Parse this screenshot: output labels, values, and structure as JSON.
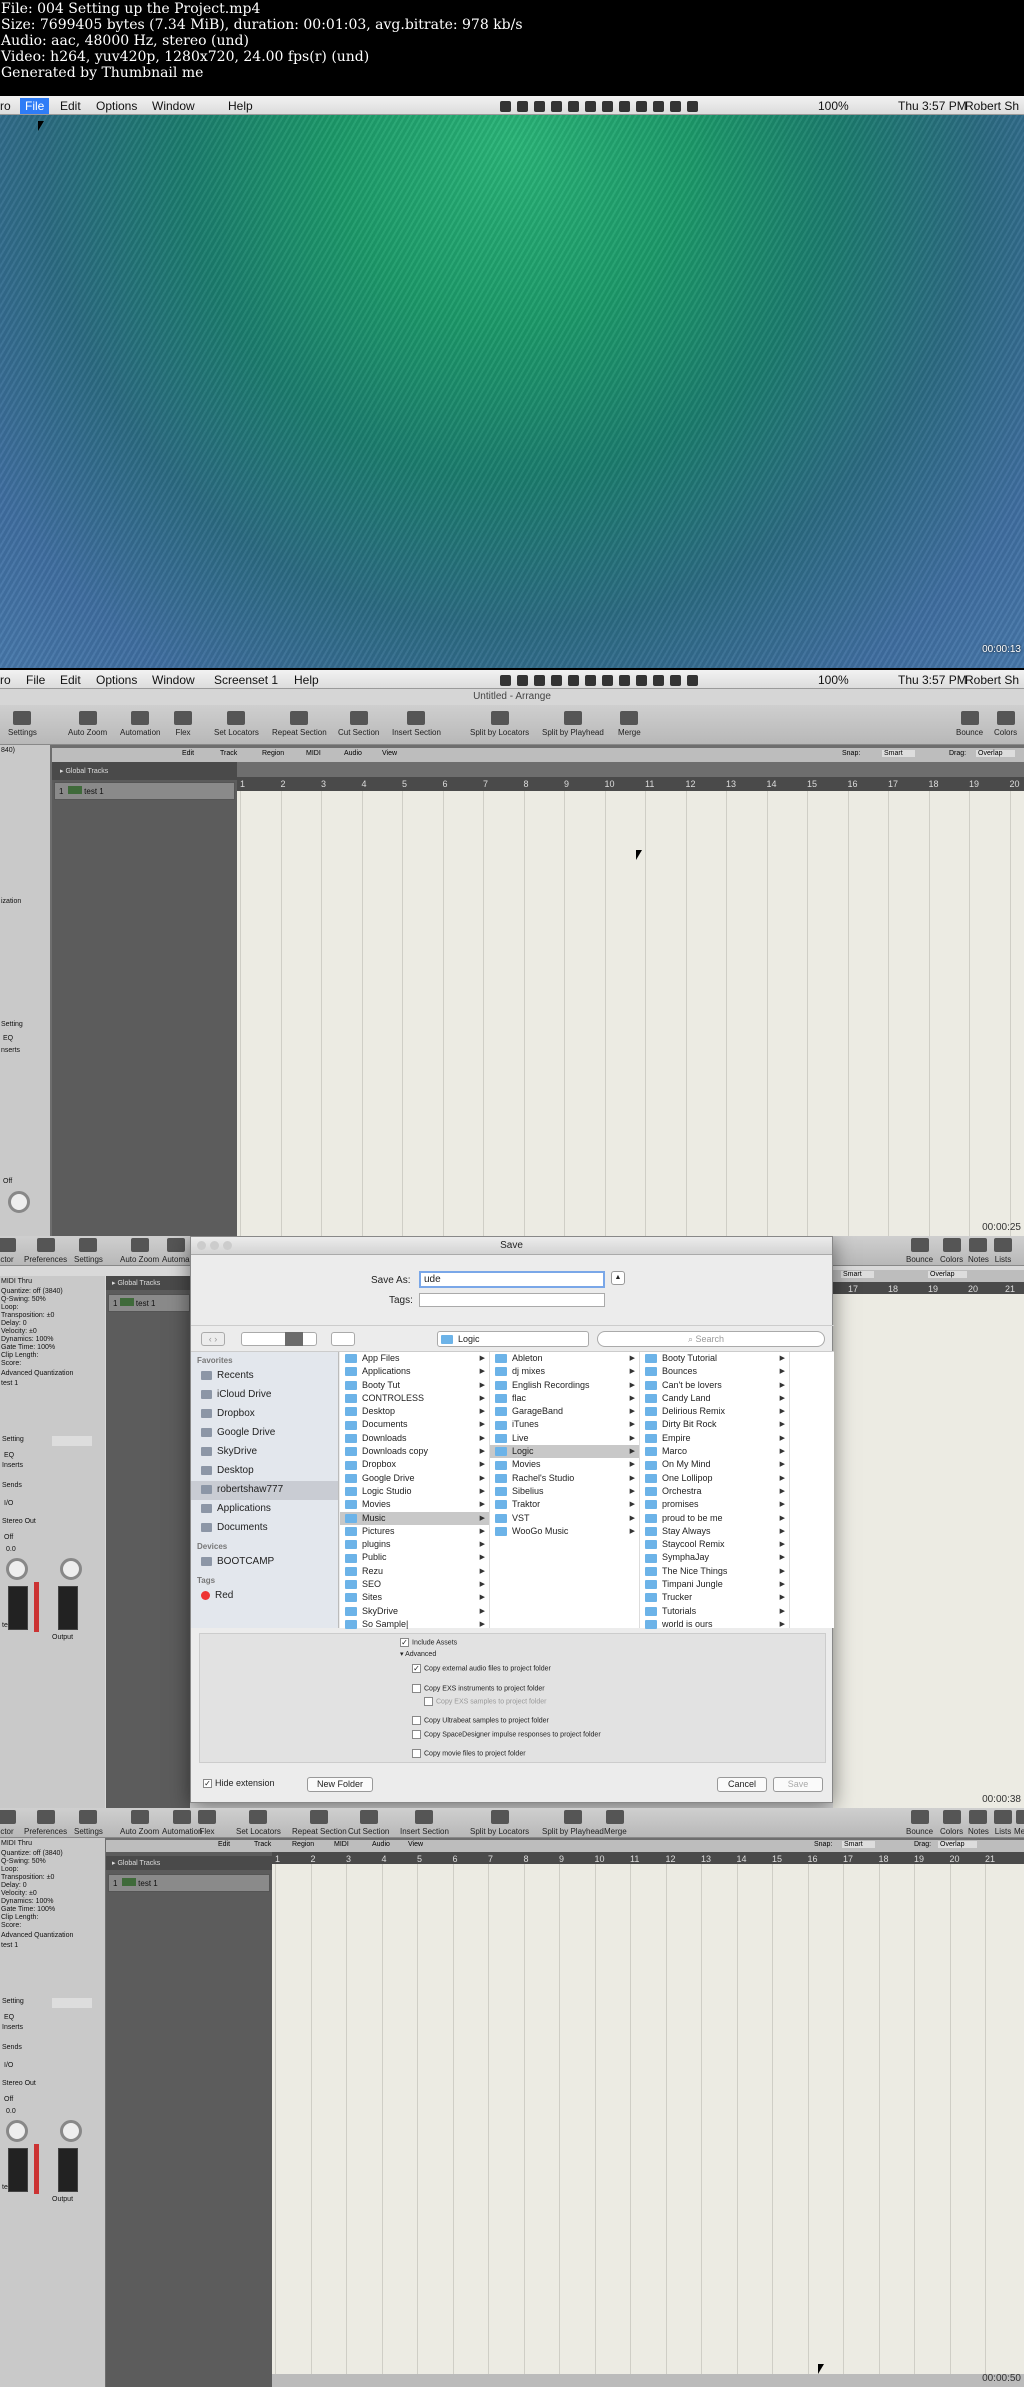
{
  "meta": {
    "lines": [
      "File: 004 Setting up the Project.mp4",
      "Size: 7699405 bytes (7.34 MiB), duration: 00:01:03, avg.bitrate: 978 kb/s",
      "Audio: aac, 48000 Hz, stereo (und)",
      "Video: h264, yuv420p, 1280x720, 24.00 fps(r) (und)",
      "Generated by Thumbnail me"
    ]
  },
  "frame1": {
    "menu": {
      "app": "ro",
      "items": [
        "File",
        "Edit",
        "Options",
        "Window",
        "Help"
      ],
      "right": {
        "battery": "100%",
        "clock": "Thu 3:57 PM",
        "user": "Robert Sh"
      }
    },
    "timestamp": "00:00:13"
  },
  "frame2": {
    "menu": {
      "app": "ro",
      "items": [
        "File",
        "Edit",
        "Options",
        "Window",
        "Screenset 1",
        "Help"
      ],
      "right": {
        "battery": "100%",
        "clock": "Thu 3:57 PM",
        "user": "Robert Sh"
      }
    },
    "title": "Untitled - Arrange",
    "toolbar": [
      "Settings",
      "Auto Zoom",
      "Automation",
      "Flex",
      "Set Locators",
      "Repeat Section",
      "Cut Section",
      "Insert Section",
      "Split by Locators",
      "Split by Playhead",
      "Merge",
      "Bounce",
      "Colors"
    ],
    "subtoolbar": [
      "Edit",
      "Track",
      "Region",
      "MIDI",
      "Audio",
      "View"
    ],
    "snap": "Snap:",
    "snap_val": "Smart",
    "drag": "Drag:",
    "drag_val": "Overlap",
    "ruler": [
      "1",
      "2",
      "3",
      "4",
      "5",
      "6",
      "7",
      "8",
      "9",
      "10",
      "11",
      "12",
      "13",
      "14",
      "15",
      "16",
      "17",
      "18",
      "19",
      "20"
    ],
    "global_tracks": "Global Tracks",
    "track": {
      "num": "1",
      "name": "test 1"
    },
    "insp_labels": [
      "840)",
      "ization",
      "Setting",
      "EQ",
      "nserts",
      "Off"
    ],
    "timestamp": "00:00:25"
  },
  "frame3": {
    "dialog": {
      "title": "Save",
      "save_as_label": "Save As:",
      "save_as_value": "ude",
      "tags_label": "Tags:",
      "location": "Logic",
      "search_placeholder": "Search",
      "favorites_header": "Favorites",
      "favorites": [
        "Recents",
        "iCloud Drive",
        "Dropbox",
        "Google Drive",
        "SkyDrive",
        "Desktop",
        "robertshaw777",
        "Applications",
        "Documents"
      ],
      "devices_header": "Devices",
      "devices": [
        "BOOTCAMP"
      ],
      "tags_header": "Tags",
      "tags": [
        "Red"
      ],
      "col1": [
        "App Files",
        "Applications",
        "Booty Tut",
        "CONTROLESS",
        "Desktop",
        "Documents",
        "Downloads",
        "Downloads copy",
        "Dropbox",
        "Google Drive",
        "Logic Studio",
        "Movies",
        "Music",
        "Pictures",
        "plugins",
        "Public",
        "Rezu",
        "SEO",
        "Sites",
        "SkyDrive",
        "So Sample|"
      ],
      "col2": [
        "Ableton",
        "dj mixes",
        "English Recordings",
        "flac",
        "GarageBand",
        "iTunes",
        "Live",
        "Logic",
        "Movies",
        "Rachel's Studio",
        "Sibelius",
        "Traktor",
        "VST",
        "WooGo Music"
      ],
      "col3": [
        "Booty Tutorial",
        "Bounces",
        "Can't be lovers",
        "Candy Land",
        "Delirious Remix",
        "Dirty Bit Rock",
        "Empire",
        "Marco",
        "On My Mind",
        "One Lollipop",
        "Orchestra",
        "promises",
        "proud to be me",
        "Stay Always",
        "Staycool Remix",
        "SymphaJay",
        "The Nice Things",
        "Timpani Jungle",
        "Trucker",
        "Tutorials",
        "world is ours"
      ],
      "include_assets": "Include Assets",
      "advanced": "Advanced",
      "options": [
        "Copy external audio files to project folder",
        "Copy EXS instruments to project folder",
        "Copy EXS samples to project folder",
        "Copy Ultrabeat samples to project folder",
        "Copy SpaceDesigner impulse responses to project folder",
        "Copy movie files to project folder"
      ],
      "hide_extension": "Hide extension",
      "new_folder": "New Folder",
      "cancel": "Cancel",
      "save": "Save"
    },
    "toolbar_left": [
      "ctor",
      "Preferences",
      "Settings",
      "Auto Zoom",
      "Automa"
    ],
    "toolbar_right": [
      "Bounce",
      "Colors",
      "Notes",
      "Lists"
    ],
    "insp": [
      "MIDI Thru",
      "Quantize: off (3840)",
      "Q-Swing: 50%",
      "Loop:",
      "Transposition: ±0",
      "Delay: 0",
      "Velocity: ±0",
      "Dynamics: 100%",
      "Gate Time: 100%",
      "Clip Length:",
      "Score:",
      "Advanced Quantization",
      "test 1",
      "Setting",
      "EQ",
      "Inserts",
      "Sends",
      "I/O",
      "Stereo Out",
      "Off",
      "0.0",
      "test 1",
      "Output"
    ],
    "track": {
      "num": "1",
      "name": "test 1"
    },
    "global_tracks": "Global Tracks",
    "ruler": [
      "17",
      "18",
      "19",
      "20",
      "21"
    ],
    "snap_val": "Smart",
    "drag_val": "Overlap",
    "timestamp": "00:00:38"
  },
  "frame4": {
    "toolbar": [
      "ctor",
      "Preferences",
      "Settings",
      "Auto Zoom",
      "Automation",
      "Flex",
      "Set Locators",
      "Repeat Section",
      "Cut Section",
      "Insert Section",
      "Split by Locators",
      "Split by Playhead",
      "Merge",
      "Bounce",
      "Colors",
      "Notes",
      "Lists",
      "Media"
    ],
    "subtoolbar": [
      "Edit",
      "Track",
      "Region",
      "MIDI",
      "Audio",
      "View"
    ],
    "snap": "Snap:",
    "snap_val": "Smart",
    "drag": "Drag:",
    "drag_val": "Overlap",
    "ruler": [
      "1",
      "2",
      "3",
      "4",
      "5",
      "6",
      "7",
      "8",
      "9",
      "10",
      "11",
      "12",
      "13",
      "14",
      "15",
      "16",
      "17",
      "18",
      "19",
      "20",
      "21"
    ],
    "global_tracks": "Global Tracks",
    "track": {
      "num": "1",
      "name": "test 1"
    },
    "insp": [
      "MIDI Thru",
      "Quantize: off (3840)",
      "Q-Swing: 50%",
      "Loop:",
      "Transposition: ±0",
      "Delay: 0",
      "Velocity: ±0",
      "Dynamics: 100%",
      "Gate Time: 100%",
      "Clip Length:",
      "Score:",
      "Advanced Quantization",
      "test 1",
      "Setting",
      "EQ",
      "Inserts",
      "Sends",
      "I/O",
      "Stereo Out",
      "Off",
      "0.0",
      "test 1",
      "Output"
    ],
    "timestamp": "00:00:50"
  }
}
